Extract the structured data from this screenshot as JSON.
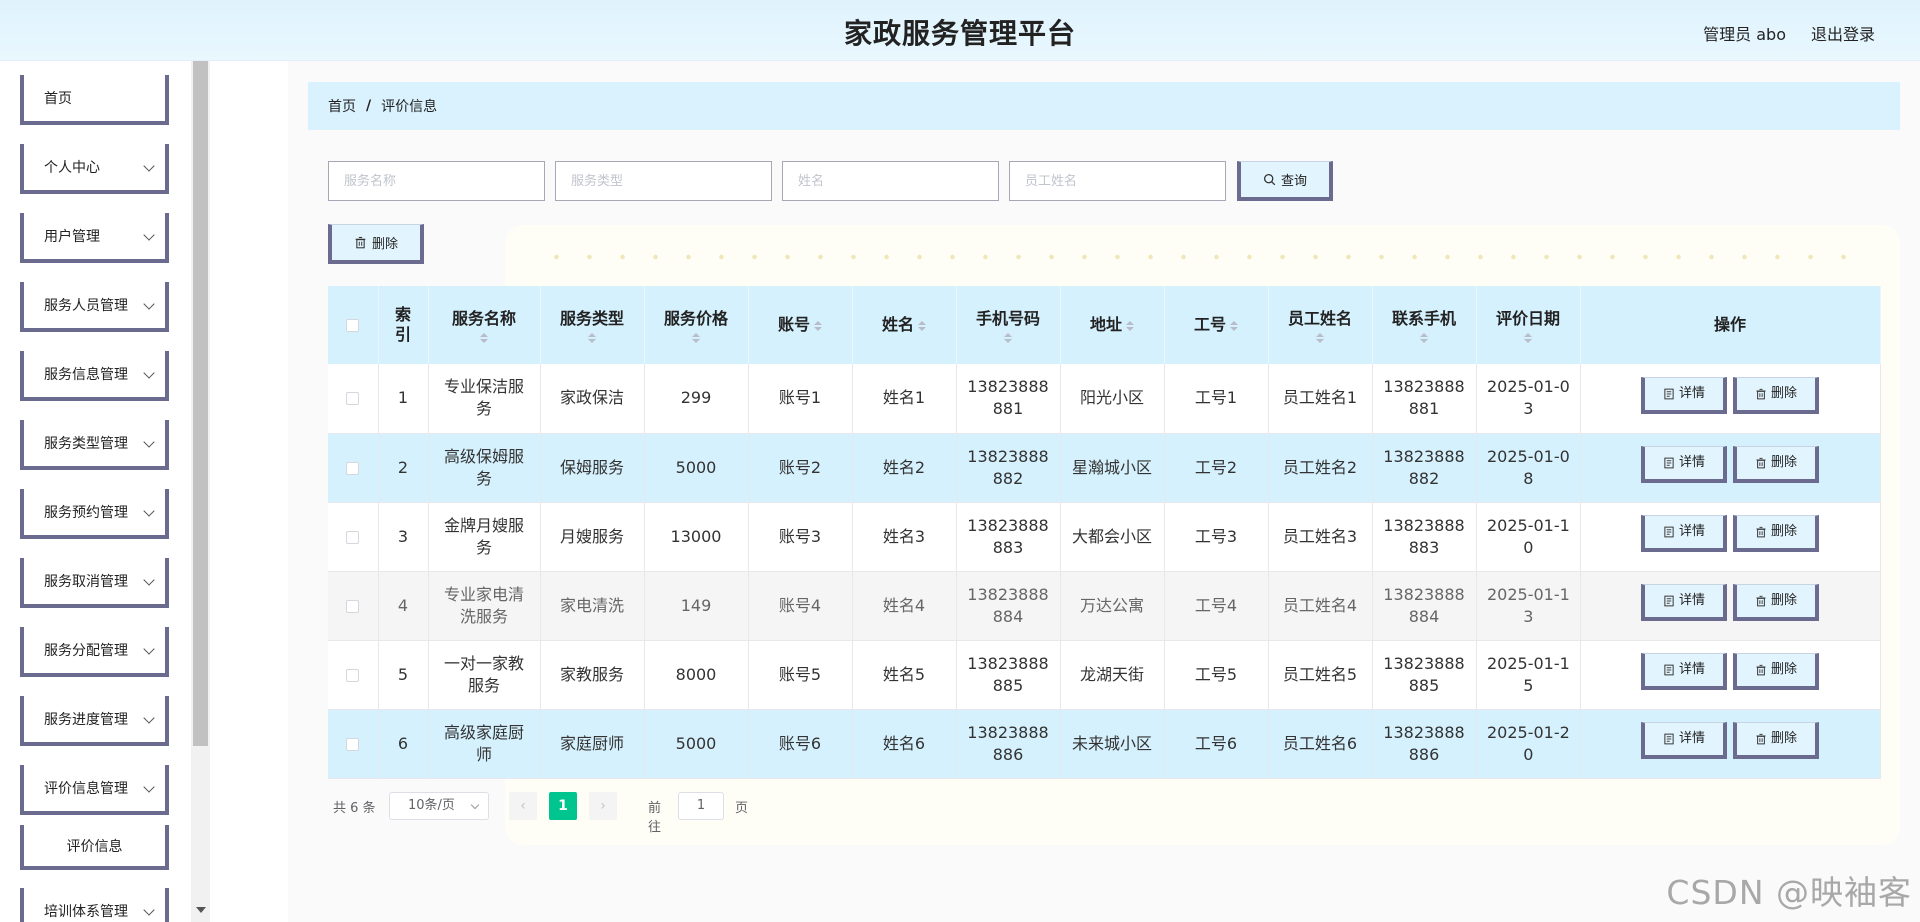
{
  "header": {
    "title": "家政服务管理平台",
    "user": "管理员 abo",
    "logout": "退出登录"
  },
  "sidebar": {
    "items": [
      {
        "label": "首页",
        "has_children": false
      },
      {
        "label": "个人中心",
        "has_children": true
      },
      {
        "label": "用户管理",
        "has_children": true
      },
      {
        "label": "服务人员管理",
        "has_children": true
      },
      {
        "label": "服务信息管理",
        "has_children": true
      },
      {
        "label": "服务类型管理",
        "has_children": true
      },
      {
        "label": "服务预约管理",
        "has_children": true
      },
      {
        "label": "服务取消管理",
        "has_children": true
      },
      {
        "label": "服务分配管理",
        "has_children": true
      },
      {
        "label": "服务进度管理",
        "has_children": true
      },
      {
        "label": "评价信息管理",
        "has_children": true
      }
    ],
    "sub_item": "评价信息",
    "partial_item": "培训体系管理"
  },
  "breadcrumb": {
    "home": "首页",
    "separator": "/",
    "current": "评价信息"
  },
  "search": {
    "service_name_placeholder": "服务名称",
    "service_type_placeholder": "服务类型",
    "name_placeholder": "姓名",
    "employee_name_placeholder": "员工姓名",
    "query_label": "查询"
  },
  "toolbar": {
    "delete_label": "删除"
  },
  "table": {
    "columns": [
      {
        "key": "index",
        "label": "索引",
        "sortable": false
      },
      {
        "key": "service_name",
        "label": "服务名称",
        "sortable": true
      },
      {
        "key": "service_type",
        "label": "服务类型",
        "sortable": true
      },
      {
        "key": "price",
        "label": "服务价格",
        "sortable": true
      },
      {
        "key": "account",
        "label": "账号",
        "sortable": true
      },
      {
        "key": "name",
        "label": "姓名",
        "sortable": true
      },
      {
        "key": "phone",
        "label": "手机号码",
        "sortable": true
      },
      {
        "key": "address",
        "label": "地址",
        "sortable": true
      },
      {
        "key": "employee_id",
        "label": "工号",
        "sortable": true
      },
      {
        "key": "employee_name",
        "label": "员工姓名",
        "sortable": true
      },
      {
        "key": "contact_phone",
        "label": "联系手机",
        "sortable": true
      },
      {
        "key": "review_date",
        "label": "评价日期",
        "sortable": true
      },
      {
        "key": "actions",
        "label": "操作",
        "sortable": false
      }
    ],
    "rows": [
      {
        "index": "1",
        "service_name": "专业保洁服务",
        "service_type": "家政保洁",
        "price": "299",
        "account": "账号1",
        "name": "姓名1",
        "phone": "13823888881",
        "address": "阳光小区",
        "employee_id": "工号1",
        "employee_name": "员工姓名1",
        "contact_phone": "13823888881",
        "review_date": "2025-01-03",
        "style": "white"
      },
      {
        "index": "2",
        "service_name": "高级保姆服务",
        "service_type": "保姆服务",
        "price": "5000",
        "account": "账号2",
        "name": "姓名2",
        "phone": "13823888882",
        "address": "星瀚城小区",
        "employee_id": "工号2",
        "employee_name": "员工姓名2",
        "contact_phone": "13823888882",
        "review_date": "2025-01-08",
        "style": "blue"
      },
      {
        "index": "3",
        "service_name": "金牌月嫂服务",
        "service_type": "月嫂服务",
        "price": "13000",
        "account": "账号3",
        "name": "姓名3",
        "phone": "13823888883",
        "address": "大都会小区",
        "employee_id": "工号3",
        "employee_name": "员工姓名3",
        "contact_phone": "13823888883",
        "review_date": "2025-01-10",
        "style": "white"
      },
      {
        "index": "4",
        "service_name": "专业家电清洗服务",
        "service_type": "家电清洗",
        "price": "149",
        "account": "账号4",
        "name": "姓名4",
        "phone": "13823888884",
        "address": "万达公寓",
        "employee_id": "工号4",
        "employee_name": "员工姓名4",
        "contact_phone": "13823888884",
        "review_date": "2025-01-13",
        "style": "gray"
      },
      {
        "index": "5",
        "service_name": "一对一家教服务",
        "service_type": "家教服务",
        "price": "8000",
        "account": "账号5",
        "name": "姓名5",
        "phone": "13823888885",
        "address": "龙湖天街",
        "employee_id": "工号5",
        "employee_name": "员工姓名5",
        "contact_phone": "13823888885",
        "review_date": "2025-01-15",
        "style": "white"
      },
      {
        "index": "6",
        "service_name": "高级家庭厨师",
        "service_type": "家庭厨师",
        "price": "5000",
        "account": "账号6",
        "name": "姓名6",
        "phone": "13823888886",
        "address": "未来城小区",
        "employee_id": "工号6",
        "employee_name": "员工姓名6",
        "contact_phone": "13823888886",
        "review_date": "2025-01-20",
        "style": "blue"
      }
    ],
    "detail_label": "详情",
    "delete_label": "删除"
  },
  "pagination": {
    "total_text": "共 6 条",
    "page_size": "10条/页",
    "current_page": "1",
    "goto_label": "前往",
    "goto_value": "1",
    "page_suffix": "页"
  },
  "watermark": "CSDN @映袖客",
  "colors": {
    "header_bg": "#dff3fd",
    "breadcrumb_bg": "#d9f2fe",
    "table_header_bg": "#d6f1fe",
    "button_bg": "#e2f4fd",
    "button_border": "#6b6b8f",
    "pager_active": "#00c58e"
  }
}
